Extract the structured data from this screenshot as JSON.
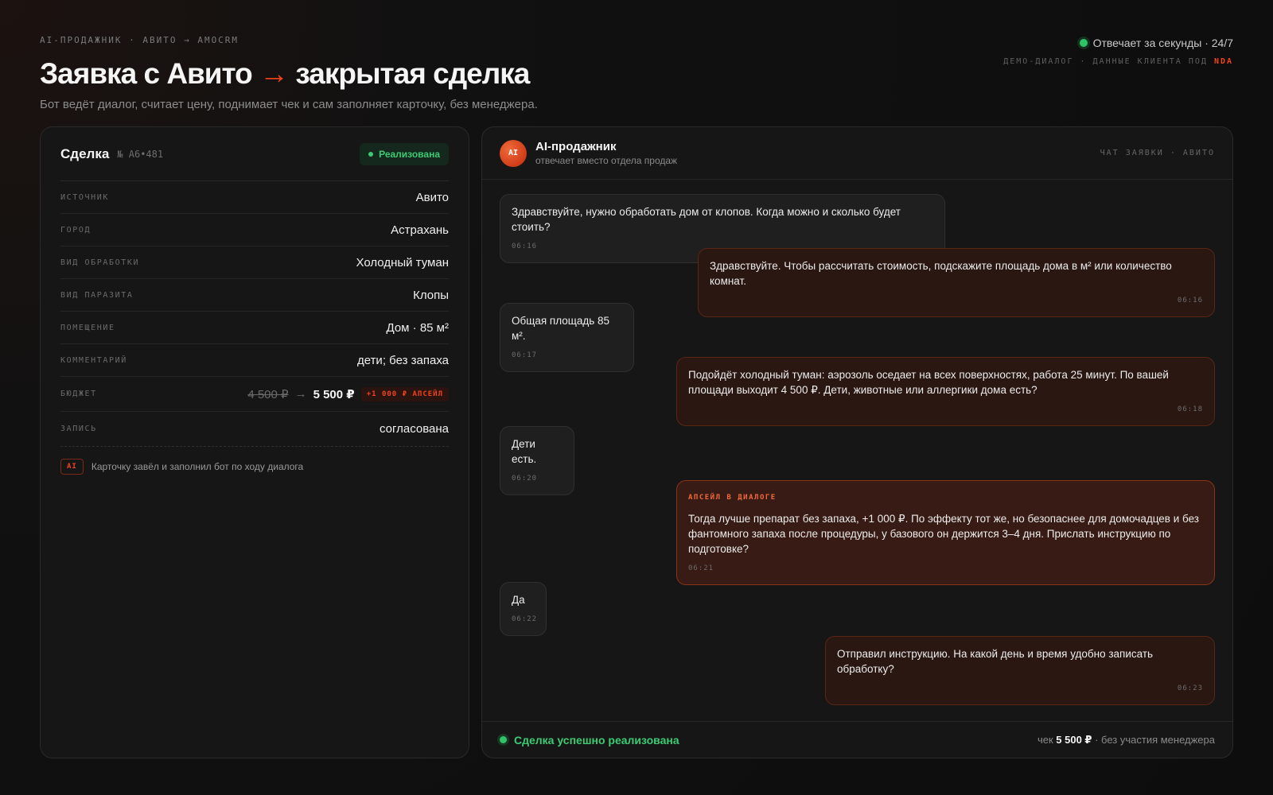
{
  "header": {
    "eyebrow": "AI-ПРОДАЖНИК · АВИТО → AMOCRM",
    "title_part1": "Заявка с Авито",
    "title_arrow": "→",
    "title_part2": "закрытая сделка",
    "subtitle": "Бот ведёт диалог, считает цену, поднимает чек и сам заполняет карточку, без менеджера.",
    "status": "Отвечает за секунды · 24/7",
    "nda_prefix": "ДЕМО-ДИАЛОГ · ДАННЫЕ КЛИЕНТА ПОД",
    "nda_word": "NDA"
  },
  "deal": {
    "title": "Сделка",
    "number": "№ A6•481",
    "status": "Реализована",
    "fields": [
      {
        "label": "ИСТОЧНИК",
        "value": "Авито"
      },
      {
        "label": "ГОРОД",
        "value": "Астрахань"
      },
      {
        "label": "ВИД ОБРАБОТКИ",
        "value": "Холодный туман"
      },
      {
        "label": "ВИД ПАРАЗИТА",
        "value": "Клопы"
      },
      {
        "label": "ПОМЕЩЕНИЕ",
        "value": "Дом · 85 м²"
      },
      {
        "label": "КОММЕНТАРИЙ",
        "value": "дети; без запаха"
      }
    ],
    "budget": {
      "label": "БЮДЖЕТ",
      "old": "4 500 ₽",
      "arrow": "→",
      "new": "5 500 ₽",
      "chip": "+1 000 ₽ АПСЕЙЛ"
    },
    "record": {
      "label": "ЗАПИСЬ",
      "value": "согласована"
    },
    "ai_tag": "AI",
    "ai_note": "Карточку завёл и заполнил бот по ходу диалога"
  },
  "chat": {
    "bot_avatar": "AI",
    "bot_name": "AI-продажник",
    "bot_sub": "отвечает вместо отдела продаж",
    "tag": "ЧАТ ЗАЯВКИ · АВИТО",
    "messages": [
      {
        "side": "in",
        "text": "Здравствуйте, нужно обработать дом от клопов. Когда можно и сколько будет стоить?",
        "time": "06:16"
      },
      {
        "side": "out",
        "text": "Здравствуйте. Чтобы рассчитать стоимость, подскажите площадь дома в м² или количество комнат.",
        "time": "06:16"
      },
      {
        "side": "in",
        "text": "Общая площадь 85 м².",
        "time": "06:17"
      },
      {
        "side": "out",
        "text": "Подойдёт холодный туман: аэрозоль оседает на всех поверхностях, работа 25 минут. По вашей площади выходит 4 500 ₽. Дети, животные или аллергики дома есть?",
        "time": "06:18"
      },
      {
        "side": "in",
        "text": "Дети есть.",
        "time": "06:20"
      },
      {
        "side": "upsell",
        "tag": "АПСЕЙЛ В ДИАЛОГЕ",
        "text": "Тогда лучше препарат без запаха, +1 000 ₽. По эффекту тот же, но безопаснее для домочадцев и без фантомного запаха после процедуры, у базового он держится 3–4 дня. Прислать инструкцию по подготовке?",
        "time": "06:21"
      },
      {
        "side": "in",
        "text": "Да",
        "time": "06:22"
      },
      {
        "side": "out",
        "text": "Отправил инструкцию. На какой день и время удобно записать обработку?",
        "time": "06:23"
      }
    ],
    "footer_status": "Сделка успешно реализована",
    "footer_check_prefix": "чек",
    "footer_check_value": "5 500 ₽",
    "footer_check_suffix": "· без участия менеджера"
  },
  "colors": {
    "accent": "#f0441a",
    "success": "#3ccb73",
    "background": "#111111",
    "card": "#161616"
  }
}
